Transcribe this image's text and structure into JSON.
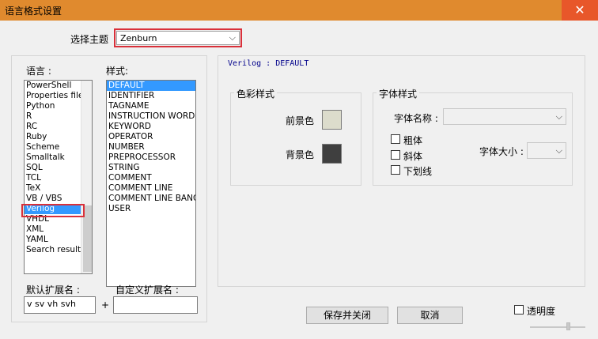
{
  "window": {
    "title": "语言格式设置",
    "close_glyph": "✕"
  },
  "theme": {
    "label": "选择主题",
    "selected": "Zenburn"
  },
  "languages": {
    "label": "语言 :",
    "items": [
      "PowerShell",
      "Properties file",
      "Python",
      "R",
      "RC",
      "Ruby",
      "Scheme",
      "Smalltalk",
      "SQL",
      "TCL",
      "TeX",
      "VB / VBS",
      "Verilog",
      "VHDL",
      "XML",
      "YAML",
      "Search result"
    ],
    "selected": "Verilog"
  },
  "styles": {
    "label": "样式:",
    "items": [
      "DEFAULT",
      "IDENTIFIER",
      "TAGNAME",
      "INSTRUCTION WORD",
      "KEYWORD",
      "OPERATOR",
      "NUMBER",
      "PREPROCESSOR",
      "STRING",
      "COMMENT",
      "COMMENT LINE",
      "COMMENT LINE BANG",
      "USER"
    ],
    "selected": "DEFAULT"
  },
  "extensions": {
    "default_label": "默认扩展名 :",
    "default_value": "v sv vh svh",
    "plus": "+",
    "custom_label": "自定义扩展名 :",
    "custom_value": ""
  },
  "style_panel": {
    "header": "Verilog : DEFAULT",
    "colors": {
      "group_label": "色彩样式",
      "foreground_label": "前景色",
      "foreground_color": "#dcdccc",
      "background_label": "背景色",
      "background_color": "#3f3f3f"
    },
    "font": {
      "group_label": "字体样式",
      "name_label": "字体名称 :",
      "name_value": "",
      "bold_label": "粗体",
      "italic_label": "斜体",
      "underline_label": "下划线",
      "size_label": "字体大小 :",
      "size_value": ""
    }
  },
  "buttons": {
    "save_close": "保存并关闭",
    "cancel": "取消"
  },
  "transparency": {
    "label": "透明度"
  },
  "accent_colors": {
    "title_bar": "#e08a2e",
    "selection": "#3399ff",
    "highlight_box": "#d9303a"
  }
}
